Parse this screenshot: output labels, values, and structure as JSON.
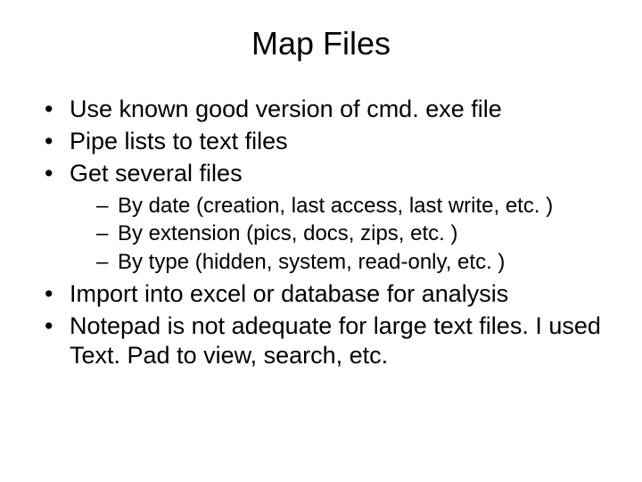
{
  "title": "Map Files",
  "bullets": [
    {
      "text": "Use known good version of cmd. exe file"
    },
    {
      "text": "Pipe lists to text files"
    },
    {
      "text": "Get several files",
      "subs": [
        "By date (creation, last access, last write, etc. )",
        "By extension (pics, docs, zips, etc. )",
        "By type (hidden, system, read-only, etc. )"
      ]
    },
    {
      "text": "Import into excel or database for analysis"
    },
    {
      "text": "Notepad is not adequate for large text files. I used Text. Pad to view, search, etc."
    }
  ]
}
